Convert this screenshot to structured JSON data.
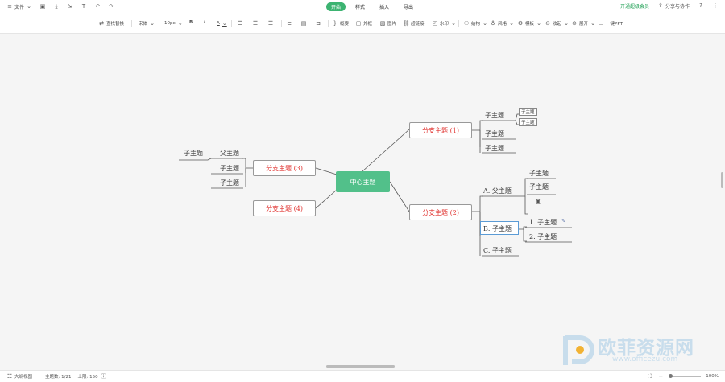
{
  "topbar": {
    "file_label": "文件",
    "tabs": [
      {
        "label": "开始",
        "active": true
      },
      {
        "label": "样式",
        "active": false
      },
      {
        "label": "插入",
        "active": false
      },
      {
        "label": "导出",
        "active": false
      }
    ],
    "vip_label": "开通超级会员",
    "share_label": "分享与协作"
  },
  "toolbar": {
    "find_replace": "查找替换",
    "font_name": "宋体",
    "font_size": "10px",
    "summary": "概要",
    "outline": "外框",
    "image": "图片",
    "hyperlink": "超链接",
    "watermark": "水印",
    "layout": "结构",
    "style": "风格",
    "branch": "模板",
    "collapse": "收起",
    "expand": "展开",
    "export_ppt": "一键PPT"
  },
  "mindmap": {
    "center": "中心主题",
    "branch1": "分支主题 (1)",
    "branch2": "分支主题 (2)",
    "branch3": "分支主题 (3)",
    "branch4": "分支主题 (4)",
    "b1_sub1": "子主题",
    "b1_sub1_child1": "子主题",
    "b1_sub1_child2": "子主题",
    "b1_sub2": "子主题",
    "b1_sub3": "子主题",
    "b2_a": "A. 父主题",
    "b2_a_child1": "子主题",
    "b2_a_child2": "子主题",
    "b2_b": "B. 子主题",
    "b2_b_child1": "1. 子主题",
    "b2_b_child2": "2. 子主题",
    "b2_c": "C. 子主题",
    "b3_parent": "父主题",
    "b3_parent_child": "子主题",
    "b3_sub2": "子主题",
    "b3_sub3": "子主题"
  },
  "statusbar": {
    "outline_view": "大纲视图",
    "topic_count": "主题数: 1/21",
    "limit": "上限: 150",
    "zoom": "100%"
  },
  "watermark": {
    "text": "欧菲资源网",
    "url": "www.officezu.com"
  },
  "colors": {
    "accent": "#3cb371",
    "center_node": "#52c08a",
    "branch_text": "#e0312e",
    "line": "#555555"
  }
}
